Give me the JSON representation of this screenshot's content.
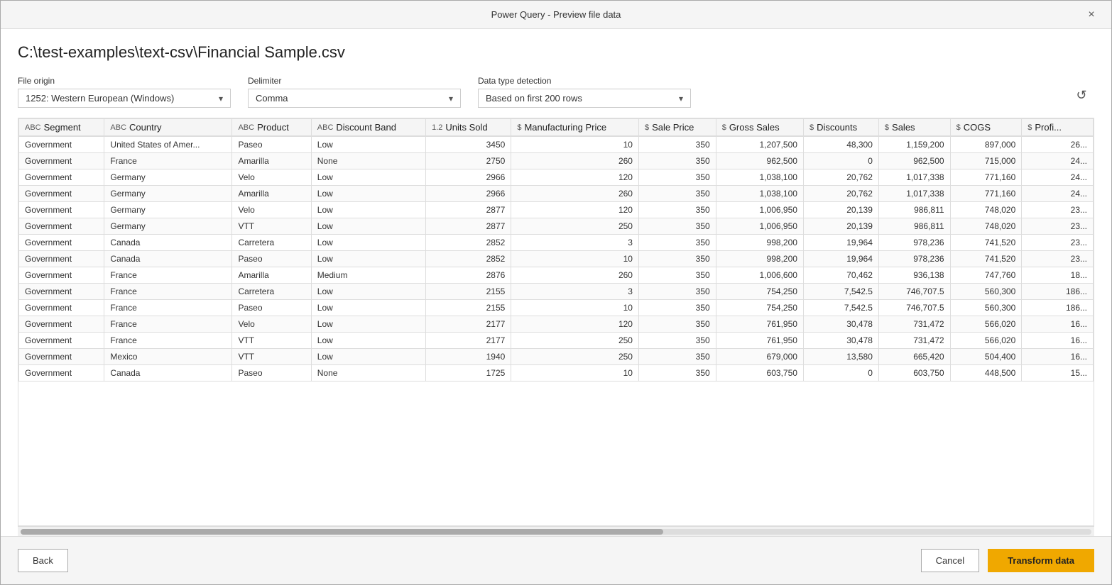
{
  "titleBar": {
    "title": "Power Query - Preview file data",
    "closeLabel": "×"
  },
  "filePath": "C:\\test-examples\\text-csv\\Financial Sample.csv",
  "controls": {
    "fileOriginLabel": "File origin",
    "fileOriginValue": "1252: Western European (Windows)",
    "delimiterLabel": "Delimiter",
    "delimiterValue": "Comma",
    "detectionLabel": "Data type detection",
    "detectionValue": "Based on first 200 rows"
  },
  "table": {
    "columns": [
      {
        "id": "segment",
        "typeIcon": "ABC",
        "name": "Segment"
      },
      {
        "id": "country",
        "typeIcon": "ABC",
        "name": "Country"
      },
      {
        "id": "product",
        "typeIcon": "ABC",
        "name": "Product"
      },
      {
        "id": "discountBand",
        "typeIcon": "ABC",
        "name": "Discount Band"
      },
      {
        "id": "unitsSold",
        "typeIcon": "1.2",
        "name": "Units Sold"
      },
      {
        "id": "manufacturingPrice",
        "typeIcon": "$",
        "name": "Manufacturing Price"
      },
      {
        "id": "salePrice",
        "typeIcon": "$",
        "name": "Sale Price"
      },
      {
        "id": "grossSales",
        "typeIcon": "$",
        "name": "Gross Sales"
      },
      {
        "id": "discounts",
        "typeIcon": "$",
        "name": "Discounts"
      },
      {
        "id": "sales",
        "typeIcon": "$",
        "name": "Sales"
      },
      {
        "id": "cogs",
        "typeIcon": "$",
        "name": "COGS"
      },
      {
        "id": "profit",
        "typeIcon": "$",
        "name": "Profi..."
      }
    ],
    "rows": [
      [
        "Government",
        "United States of Amer...",
        "Paseo",
        "Low",
        "3450",
        "10",
        "350",
        "1,207,500",
        "48,300",
        "1,159,200",
        "897,000",
        "26..."
      ],
      [
        "Government",
        "France",
        "Amarilla",
        "None",
        "2750",
        "260",
        "350",
        "962,500",
        "0",
        "962,500",
        "715,000",
        "24..."
      ],
      [
        "Government",
        "Germany",
        "Velo",
        "Low",
        "2966",
        "120",
        "350",
        "1,038,100",
        "20,762",
        "1,017,338",
        "771,160",
        "24..."
      ],
      [
        "Government",
        "Germany",
        "Amarilla",
        "Low",
        "2966",
        "260",
        "350",
        "1,038,100",
        "20,762",
        "1,017,338",
        "771,160",
        "24..."
      ],
      [
        "Government",
        "Germany",
        "Velo",
        "Low",
        "2877",
        "120",
        "350",
        "1,006,950",
        "20,139",
        "986,811",
        "748,020",
        "23..."
      ],
      [
        "Government",
        "Germany",
        "VTT",
        "Low",
        "2877",
        "250",
        "350",
        "1,006,950",
        "20,139",
        "986,811",
        "748,020",
        "23..."
      ],
      [
        "Government",
        "Canada",
        "Carretera",
        "Low",
        "2852",
        "3",
        "350",
        "998,200",
        "19,964",
        "978,236",
        "741,520",
        "23..."
      ],
      [
        "Government",
        "Canada",
        "Paseo",
        "Low",
        "2852",
        "10",
        "350",
        "998,200",
        "19,964",
        "978,236",
        "741,520",
        "23..."
      ],
      [
        "Government",
        "France",
        "Amarilla",
        "Medium",
        "2876",
        "260",
        "350",
        "1,006,600",
        "70,462",
        "936,138",
        "747,760",
        "18..."
      ],
      [
        "Government",
        "France",
        "Carretera",
        "Low",
        "2155",
        "3",
        "350",
        "754,250",
        "7,542.5",
        "746,707.5",
        "560,300",
        "186..."
      ],
      [
        "Government",
        "France",
        "Paseo",
        "Low",
        "2155",
        "10",
        "350",
        "754,250",
        "7,542.5",
        "746,707.5",
        "560,300",
        "186..."
      ],
      [
        "Government",
        "France",
        "Velo",
        "Low",
        "2177",
        "120",
        "350",
        "761,950",
        "30,478",
        "731,472",
        "566,020",
        "16..."
      ],
      [
        "Government",
        "France",
        "VTT",
        "Low",
        "2177",
        "250",
        "350",
        "761,950",
        "30,478",
        "731,472",
        "566,020",
        "16..."
      ],
      [
        "Government",
        "Mexico",
        "VTT",
        "Low",
        "1940",
        "250",
        "350",
        "679,000",
        "13,580",
        "665,420",
        "504,400",
        "16..."
      ],
      [
        "Government",
        "Canada",
        "Paseo",
        "None",
        "1725",
        "10",
        "350",
        "603,750",
        "0",
        "603,750",
        "448,500",
        "15..."
      ]
    ]
  },
  "footer": {
    "backLabel": "Back",
    "cancelLabel": "Cancel",
    "transformLabel": "Transform data"
  }
}
